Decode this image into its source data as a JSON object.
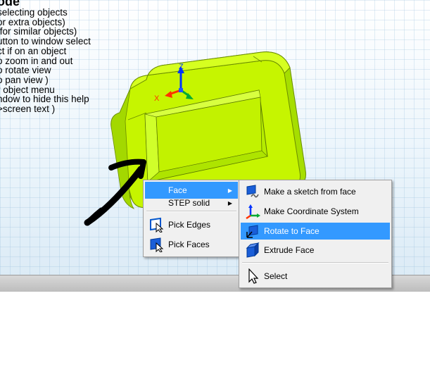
{
  "help_text": {
    "heading": "ode",
    "lines": [
      "selecting objects",
      "or extra objects)",
      " for similar objects)",
      "utton to window select",
      "ct if on an object",
      "o zoom in and out",
      "o rotate view",
      "o pan view )",
      "r object menu",
      "ndow to hide this help",
      ">screen text )"
    ]
  },
  "axes": {
    "z_label": "Z",
    "x_label": "X"
  },
  "primary_menu": {
    "items": [
      {
        "label": "Face",
        "has_submenu": true,
        "highlighted": true
      },
      {
        "label": "STEP solid",
        "has_submenu": true,
        "highlighted": false
      },
      {
        "label": "Pick Edges",
        "icon": "pick-edges-icon"
      },
      {
        "label": "Pick Faces",
        "icon": "pick-faces-icon"
      }
    ]
  },
  "sub_menu": {
    "items": [
      {
        "label": "Make a sketch from face",
        "icon": "sketch-from-face-icon"
      },
      {
        "label": "Make Coordinate System",
        "icon": "coordinate-system-icon"
      },
      {
        "label": "Rotate to Face",
        "icon": "rotate-to-face-icon",
        "highlighted": true
      },
      {
        "label": "Extrude Face",
        "icon": "extrude-face-icon"
      },
      {
        "label": "Select",
        "icon": "select-cursor-icon"
      }
    ]
  },
  "colors": {
    "solid": "#b8f000",
    "highlight": "#3399ff",
    "menu_bg": "#f0f0f0"
  }
}
